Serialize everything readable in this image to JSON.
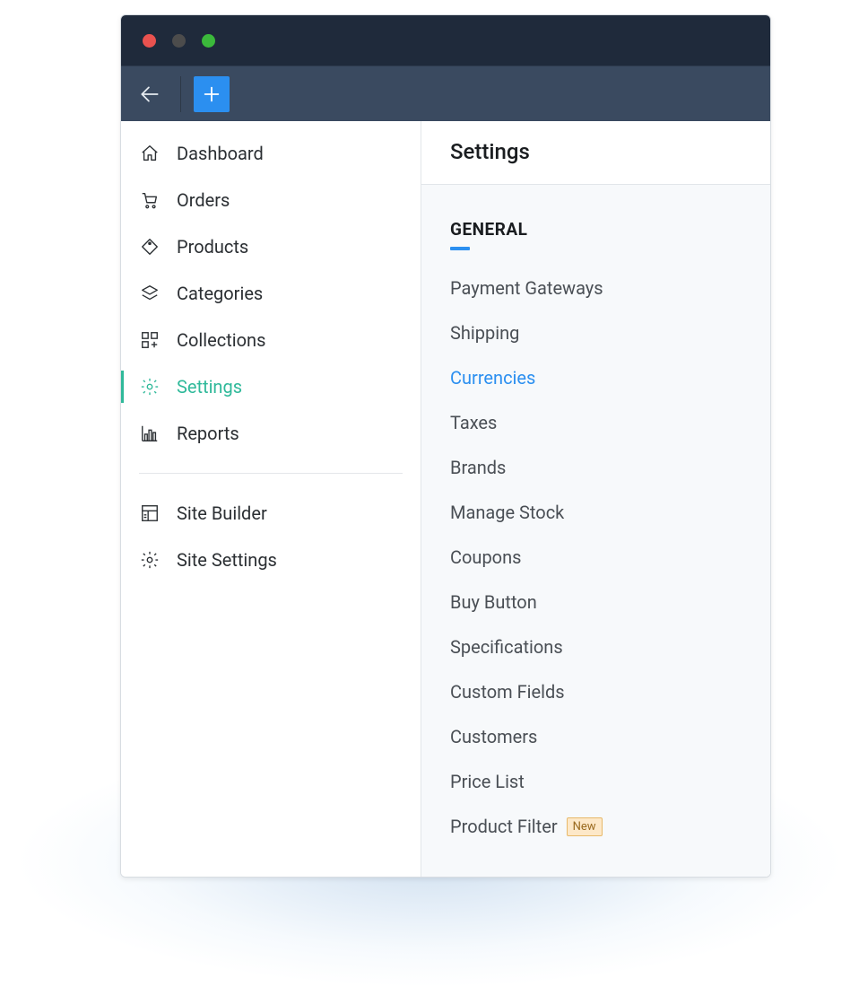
{
  "window": {
    "traffic": {
      "red": "#e9524f",
      "yellow": "#4c4c4c",
      "green": "#3bb93b"
    }
  },
  "sidebar": {
    "items": [
      {
        "label": "Dashboard"
      },
      {
        "label": "Orders"
      },
      {
        "label": "Products"
      },
      {
        "label": "Categories"
      },
      {
        "label": "Collections"
      },
      {
        "label": "Settings"
      },
      {
        "label": "Reports"
      }
    ],
    "secondary": [
      {
        "label": "Site Builder"
      },
      {
        "label": "Site Settings"
      }
    ]
  },
  "main": {
    "title": "Settings",
    "section": "GENERAL",
    "items": [
      {
        "label": "Payment Gateways"
      },
      {
        "label": "Shipping"
      },
      {
        "label": "Currencies"
      },
      {
        "label": "Taxes"
      },
      {
        "label": "Brands"
      },
      {
        "label": "Manage Stock"
      },
      {
        "label": "Coupons"
      },
      {
        "label": "Buy Button"
      },
      {
        "label": "Specifications"
      },
      {
        "label": "Custom Fields"
      },
      {
        "label": "Customers"
      },
      {
        "label": "Price List"
      },
      {
        "label": "Product Filter",
        "badge": "New"
      }
    ]
  }
}
